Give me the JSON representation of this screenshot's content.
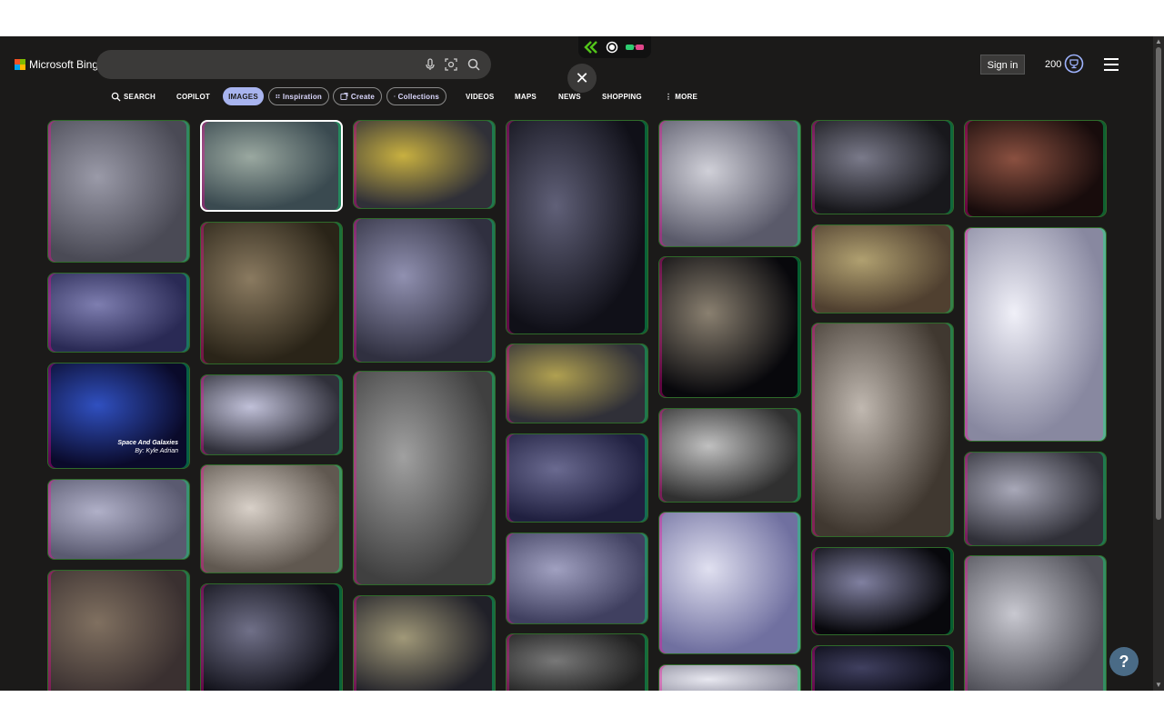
{
  "header": {
    "brand": "Microsoft Bing",
    "search_placeholder": "",
    "sign_in": "Sign in",
    "points": "200"
  },
  "tabs": [
    {
      "label": "SEARCH",
      "icon": "search-icon"
    },
    {
      "label": "COPILOT"
    },
    {
      "label": "IMAGES",
      "active": true
    },
    {
      "label": "Inspiration",
      "icon": "inspiration-icon"
    },
    {
      "label": "Create",
      "icon": "create-icon"
    },
    {
      "label": "Collections",
      "icon": "collections-icon"
    },
    {
      "label": "VIDEOS"
    },
    {
      "label": "MAPS"
    },
    {
      "label": "NEWS"
    },
    {
      "label": "SHOPPING"
    },
    {
      "label": "MORE",
      "icon": "more-dots-icon"
    }
  ],
  "images": [
    {
      "name": "astronauts-portal",
      "colors": [
        "#4a4a55",
        "#9a9aa8"
      ]
    },
    {
      "name": "space-shuttle-landing",
      "colors": [
        "#2a2a55",
        "#7e7eb0"
      ]
    },
    {
      "name": "space-and-galaxies",
      "colors": [
        "#0a0a2a",
        "#3050c0"
      ],
      "caption": "Space And Galaxies",
      "credit": "By: Kyle Adrian"
    },
    {
      "name": "jets-flying",
      "colors": [
        "#5a5a70",
        "#b0b0c8"
      ]
    },
    {
      "name": "yellow-car-garage",
      "colors": [
        "#3a3030",
        "#807060"
      ]
    },
    {
      "name": "pillars-of-creation",
      "colors": [
        "#3a4a50",
        "#9aa8a0"
      ],
      "selected": true
    },
    {
      "name": "spaceship-cave",
      "colors": [
        "#2a2418",
        "#8a7a60"
      ]
    },
    {
      "name": "rocket-planet",
      "colors": [
        "#30303a",
        "#c0c0d8"
      ]
    },
    {
      "name": "astronaut-helmet-pod",
      "colors": [
        "#605850",
        "#d8d0c8"
      ]
    },
    {
      "name": "rocket-launch-dark",
      "colors": [
        "#101018",
        "#707088"
      ]
    },
    {
      "name": "minions-row",
      "colors": [
        "#303038",
        "#c8b040"
      ]
    },
    {
      "name": "cockpit-pilot",
      "colors": [
        "#303040",
        "#9090b0"
      ]
    },
    {
      "name": "propeller-plane",
      "colors": [
        "#404040",
        "#a0a0a0"
      ]
    },
    {
      "name": "spaceship-rings",
      "colors": [
        "#202028",
        "#a09878"
      ]
    },
    {
      "name": "starship-landing",
      "colors": [
        "#101018",
        "#606078"
      ]
    },
    {
      "name": "minions-cockpit",
      "colors": [
        "#303038",
        "#b0a050"
      ]
    },
    {
      "name": "launch-pad",
      "colors": [
        "#202040",
        "#6a6a90"
      ]
    },
    {
      "name": "warplanes-clouds",
      "colors": [
        "#404060",
        "#a0a0c0"
      ]
    },
    {
      "name": "canyon-river",
      "colors": [
        "#202020",
        "#787878"
      ]
    },
    {
      "name": "jet-over-clouds",
      "colors": [
        "#5a5a6a",
        "#d0d0d8"
      ]
    },
    {
      "name": "spiral-galaxy",
      "colors": [
        "#08080c",
        "#8a8070"
      ]
    },
    {
      "name": "fighter-jet-sunset",
      "colors": [
        "#303030",
        "#c0c0c0"
      ]
    },
    {
      "name": "wing-abstract",
      "colors": [
        "#7070a0",
        "#e0e0f0"
      ]
    },
    {
      "name": "white-clouds",
      "colors": [
        "#9090a0",
        "#e8e8f0"
      ]
    },
    {
      "name": "galaxy-vortex",
      "colors": [
        "#18181c",
        "#7a7a8a"
      ]
    },
    {
      "name": "sports-car-street",
      "colors": [
        "#504030",
        "#b0a070"
      ]
    },
    {
      "name": "husky-puppy",
      "colors": [
        "#403830",
        "#c0b8b0"
      ]
    },
    {
      "name": "shuttle-earth-orbit",
      "colors": [
        "#08080c",
        "#8080a0"
      ]
    },
    {
      "name": "stars-night",
      "colors": [
        "#0a0a14",
        "#404060"
      ]
    },
    {
      "name": "planet-rocket-launch",
      "colors": [
        "#180c0c",
        "#8a5040"
      ]
    },
    {
      "name": "spacecraft-engines",
      "colors": [
        "#8888a0",
        "#f0f0f8"
      ]
    },
    {
      "name": "astronaut-earth",
      "colors": [
        "#303038",
        "#a8a8b8"
      ]
    },
    {
      "name": "fighter-jet-white",
      "colors": [
        "#505058",
        "#c8c8d0"
      ]
    }
  ]
}
